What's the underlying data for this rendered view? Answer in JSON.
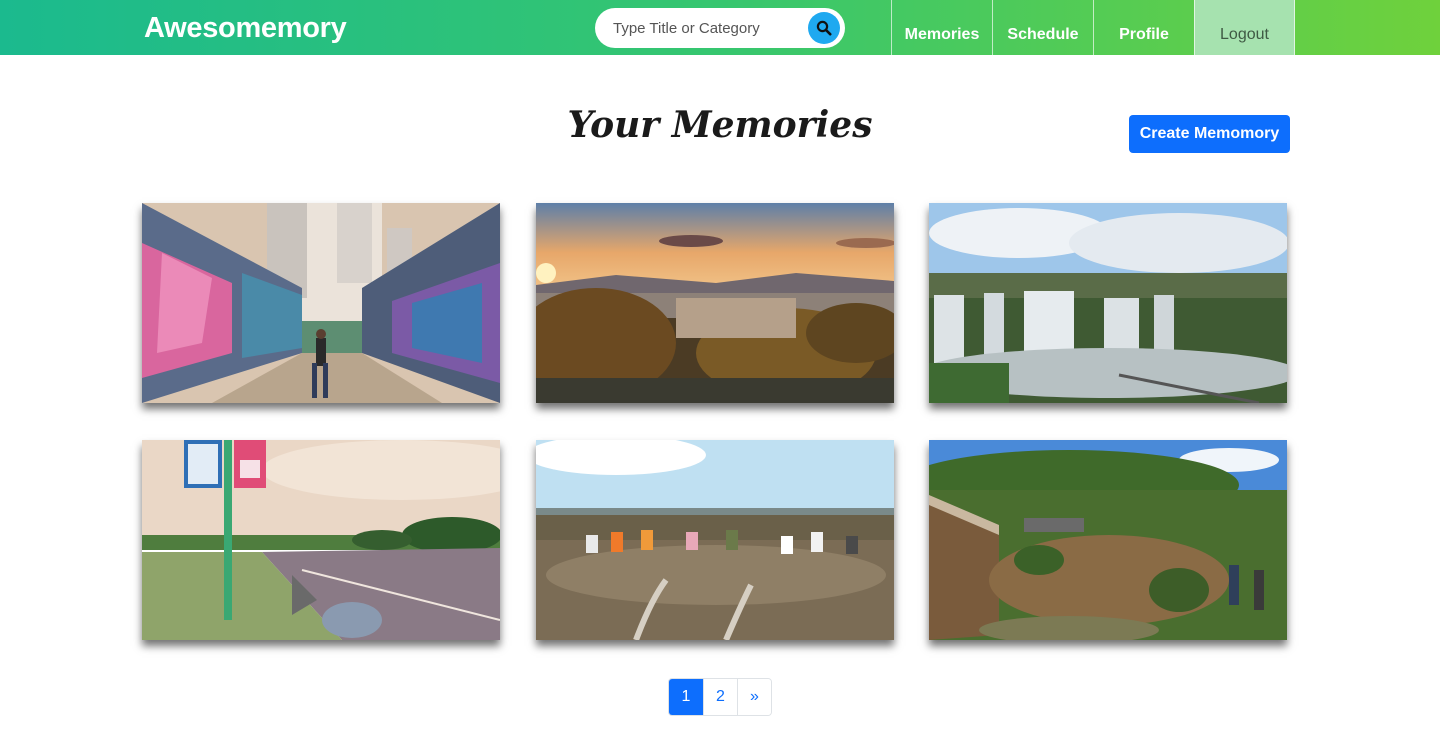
{
  "navbar": {
    "brand": "Awesomemory",
    "search": {
      "placeholder": "Type Title or Category"
    },
    "items": [
      {
        "label": "Memories"
      },
      {
        "label": "Schedule"
      },
      {
        "label": "Profile"
      },
      {
        "label": "Logout"
      }
    ]
  },
  "main": {
    "title": "Your Memories",
    "create_button": "Create Memomory"
  },
  "memories": [
    {
      "alt": "graffiti-alley"
    },
    {
      "alt": "sunset-city-view"
    },
    {
      "alt": "waterfalls"
    },
    {
      "alt": "roadside-sign"
    },
    {
      "alt": "group-in-field"
    },
    {
      "alt": "garden-pond"
    }
  ],
  "pagination": {
    "pages": [
      "1",
      "2"
    ],
    "next": "»",
    "active": 1
  },
  "colors": {
    "nav_gradient_start": "#1bba8e",
    "nav_gradient_end": "#6fd13c",
    "primary": "#0d6efd",
    "search_button": "#1fa9f0",
    "logout_bg": "#a6e2af"
  }
}
